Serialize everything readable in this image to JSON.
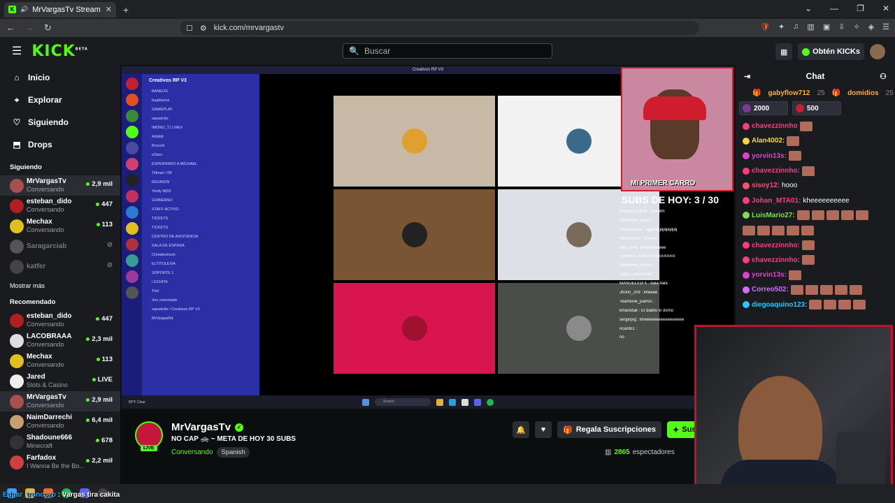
{
  "browser": {
    "tab_title": "MrVargasTv Stream - Watch l",
    "url": "kick.com/mrvargastv"
  },
  "header": {
    "search_placeholder": "Buscar",
    "get_kicks": "Obtén KICKs"
  },
  "sidebar": {
    "nav": [
      {
        "label": "Inicio",
        "icon": "home-icon"
      },
      {
        "label": "Explorar",
        "icon": "compass-icon"
      },
      {
        "label": "Siguiendo",
        "icon": "heart-icon"
      },
      {
        "label": "Drops",
        "icon": "drops-icon"
      }
    ],
    "following_title": "Siguiendo",
    "following": [
      {
        "name": "MrVargasTv",
        "sub": "Conversando",
        "viewers": "2,9 mil",
        "color": "#a85050",
        "active": true,
        "live": true
      },
      {
        "name": "esteban_dido",
        "sub": "Conversando",
        "viewers": "447",
        "color": "#b02020",
        "live": true
      },
      {
        "name": "Mechax",
        "sub": "Conversando",
        "viewers": "113",
        "color": "#e0c020",
        "live": true
      },
      {
        "name": "Saragarciab",
        "sub": "",
        "viewers": "",
        "color": "#555",
        "live": false
      },
      {
        "name": "katfer",
        "sub": "",
        "viewers": "",
        "color": "#444",
        "live": false
      }
    ],
    "show_more": "Mostrar más",
    "recommended_title": "Recomendado",
    "recommended": [
      {
        "name": "esteban_dido",
        "sub": "Conversando",
        "viewers": "447",
        "color": "#b02020"
      },
      {
        "name": "LACOBRAAA",
        "sub": "Conversando",
        "viewers": "2,3 mil",
        "color": "#ddd"
      },
      {
        "name": "Mechax",
        "sub": "Conversando",
        "viewers": "113",
        "color": "#e0c020"
      },
      {
        "name": "Jared",
        "sub": "Slots & Casino",
        "viewers": "LIVE",
        "color": "#eee"
      },
      {
        "name": "MrVargasTv",
        "sub": "Conversando",
        "viewers": "2,9 mil",
        "color": "#a85050",
        "active": true
      },
      {
        "name": "NaimDarrechi",
        "sub": "Conversando",
        "viewers": "6,4 mil",
        "color": "#c8a070"
      },
      {
        "name": "Shadoune666",
        "sub": "Minecraft",
        "viewers": "678",
        "color": "#333"
      },
      {
        "name": "Farfadox",
        "sub": "I Wanna Be the Bo...",
        "viewers": "2,2 mil",
        "color": "#d04040"
      }
    ]
  },
  "discord": {
    "window_title": "Creativos RP V3",
    "server_name": "Creativos RP V3",
    "channels": [
      "BANEOS",
      "bugdiarios",
      "GAMEPLAY",
      "squadcito",
      "IMONO_TJ | MEX",
      "Aldoblt",
      "Brocolii",
      "e2lars",
      "ESPERANDO A MICHAEL",
      "Tiltman I 08",
      "REUNION",
      "Yordy M|03",
      "GOBIERNO",
      "STAFF ACTIVO",
      "TICKETS",
      "TICKETS",
      "CENTRO DE ASISTENCIA",
      "SALA DE ESPERA",
      "Chriadestruck",
      "ELTITOLEIVA",
      "SOPORTE 1",
      "I ECHITA",
      "Trini",
      "Voz conectada",
      "squadcito / Creativos RP V3",
      "MrVargasRd"
    ],
    "tiles": [
      {
        "bg": "#c8b9a6",
        "c": "#e0a030"
      },
      {
        "bg": "#f2f2f2",
        "c": "#3a6a8a"
      },
      {
        "bg": "#7a5533",
        "c": "#222"
      },
      {
        "bg": "#dde0e6",
        "c": "#7a6a5a"
      },
      {
        "bg": "#d91550",
        "c": "#a01030"
      },
      {
        "bg": "#4a4e48",
        "c": "#8a8a8a"
      }
    ],
    "weather": "82°F Clear",
    "taskbar_search": "Search"
  },
  "overlay": {
    "cam_caption": "MI PRIMER CARRO",
    "subs_goal": "SUBS DE HOY: 3 / 30",
    "chat": [
      "AngelaSTORN : ooohhh",
      "Teamlove_juanvs :",
      "Manuel2211 : ajjjajajajajajajajaj",
      "KenerX504 : kheeee",
      "rafid_099 : kheeeeeeeee",
      "Tiltman3 : KHEEEEEEEEEEE",
      "Teamlove_juanvs :",
      "sebas_criscoman :",
      "MANUEL01FX : bala bala",
      "Jhonn_209 : kheeee",
      "Teamlove_juanvs :",
      "kmariotak : El diablo lo domo",
      "sergiojvg : kheeeeeeeeeeeeeeeee",
      "ricardo1 :",
      "no"
    ]
  },
  "stream": {
    "name": "MrVargasTv",
    "title": "NO CAP 🚓 ~ META DE HOY 30 SUBS",
    "category": "Conversando",
    "language": "Spanish",
    "live": "LIVE",
    "gift": "Regala Suscripciones",
    "subscribe": "Suscri",
    "viewers": "2865",
    "viewers_label": "espectadores"
  },
  "chat": {
    "title": "Chat",
    "gifters": [
      {
        "name": "gabyflow712",
        "count": "25"
      },
      {
        "name": "domidios",
        "count": "25"
      }
    ],
    "goals": [
      "2000",
      "500"
    ],
    "messages": [
      {
        "user": "chavezzinnho",
        "text": "",
        "color": "#ff3b7f",
        "emotes": 1
      },
      {
        "user": "Alan4002:",
        "text": "",
        "color": "#f2d44a",
        "emotes": 1
      },
      {
        "user": "yorvin13s:",
        "text": "",
        "color": "#e040d0",
        "emotes": 1
      },
      {
        "user": "chavezzinnho:",
        "text": "",
        "color": "#ff3b7f",
        "emotes": 1
      },
      {
        "user": "sisoy12:",
        "text": "hooo",
        "color": "#ff4f6f",
        "emotes": 0
      },
      {
        "user": "Johan_MTA01:",
        "text": "kheeeeeeeeee",
        "color": "#ff3b7f",
        "emotes": 0
      },
      {
        "user": "LuisMario27:",
        "text": "",
        "color": "#7ddc5a",
        "emotes": 5
      },
      {
        "user": "",
        "text": "",
        "color": "#fff",
        "emotes": 5
      },
      {
        "user": "chavezzinnho:",
        "text": "",
        "color": "#ff3b7f",
        "emotes": 1
      },
      {
        "user": "chavezzinnho:",
        "text": "",
        "color": "#ff3b7f",
        "emotes": 1
      },
      {
        "user": "yorvin13s:",
        "text": "",
        "color": "#e040d0",
        "emotes": 1
      },
      {
        "user": "Correo502:",
        "text": "",
        "color": "#d070ff",
        "emotes": 5
      },
      {
        "user": "diegoaquino123:",
        "text": "",
        "color": "#2ec4ff",
        "emotes": 4
      }
    ]
  },
  "ticker": {
    "user": "Edgar_troncozo",
    "text": " : Vargas tira cakita"
  }
}
